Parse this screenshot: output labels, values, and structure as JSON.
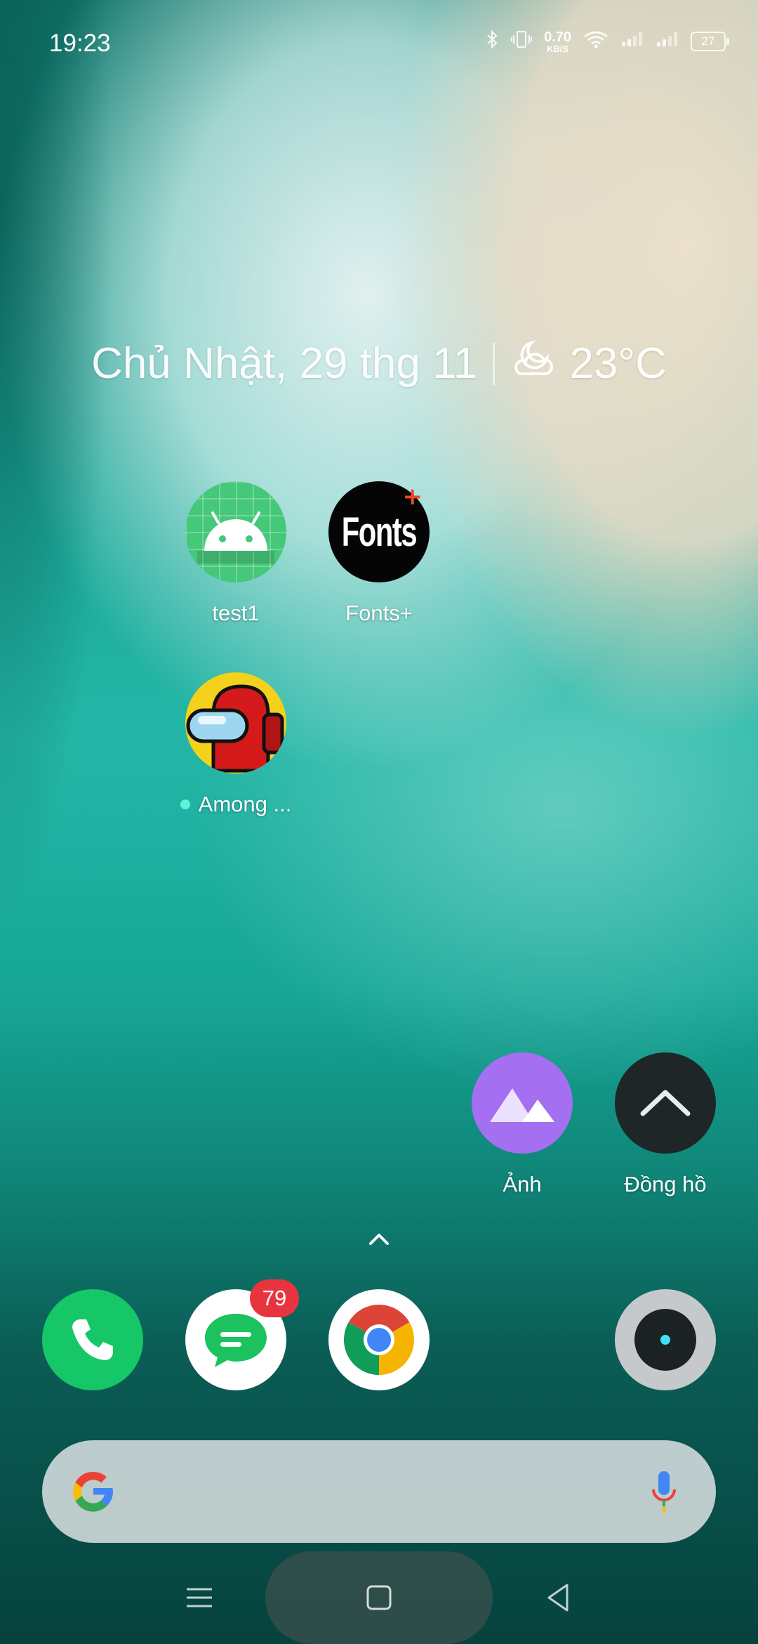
{
  "status_bar": {
    "time": "19:23",
    "net_speed_value": "0.70",
    "net_speed_unit": "KB/S",
    "battery_level": "27",
    "icons": [
      "bluetooth-icon",
      "vibrate-icon",
      "wifi-icon",
      "signal-icon",
      "signal-icon",
      "battery-icon"
    ]
  },
  "widget": {
    "date": "Chủ Nhật, 29 thg 11",
    "temperature": "23°C",
    "weather_icon": "partly-cloudy-night-icon"
  },
  "apps": [
    {
      "label": "test1",
      "icon": "android-icon"
    },
    {
      "label": "Fonts+",
      "icon": "fonts-plus-icon",
      "icon_text": "Fonts",
      "icon_plus": "+"
    },
    {
      "label": "Among ...",
      "icon": "among-us-icon",
      "new_indicator": true
    },
    {
      "label": "Ảnh",
      "icon": "photos-icon"
    },
    {
      "label": "Đồng hồ",
      "icon": "clock-icon"
    }
  ],
  "dock": [
    {
      "name": "phone",
      "icon": "phone-icon"
    },
    {
      "name": "messages",
      "icon": "messages-icon",
      "badge": "79"
    },
    {
      "name": "chrome",
      "icon": "chrome-icon"
    },
    {
      "name": "camera",
      "icon": "camera-icon"
    }
  ],
  "search": {
    "logo": "google-logo-icon",
    "mic": "mic-icon"
  },
  "colors": {
    "badge": "#e8343f",
    "phone": "#16c768",
    "photos": "#a46ff0",
    "android": "#46c87a"
  }
}
